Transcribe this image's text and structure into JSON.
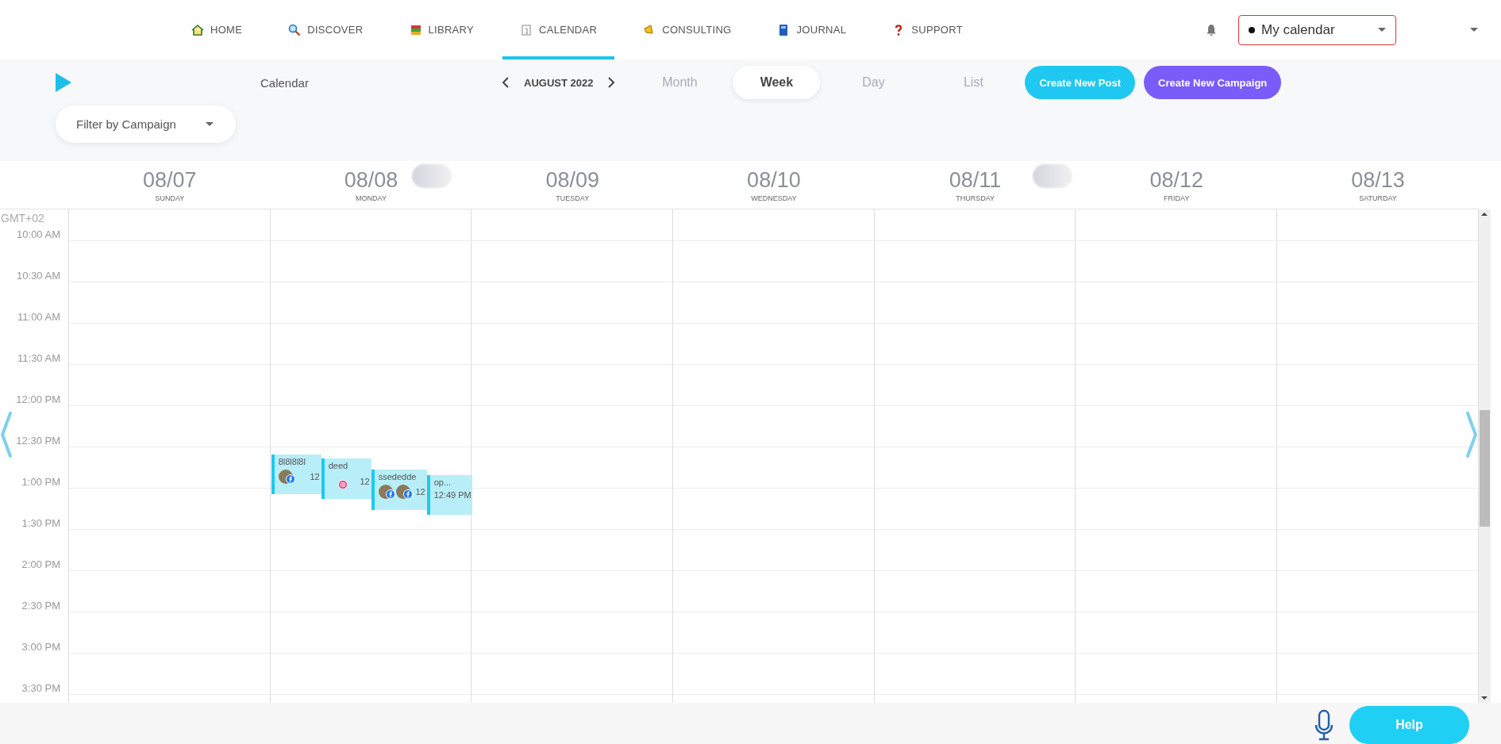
{
  "nav": {
    "items": [
      {
        "label": "HOME",
        "selected": false
      },
      {
        "label": "DISCOVER",
        "selected": false
      },
      {
        "label": "LIBRARY",
        "selected": false
      },
      {
        "label": "CALENDAR",
        "selected": true
      },
      {
        "label": "CONSULTING",
        "selected": false
      },
      {
        "label": "JOURNAL",
        "selected": false
      },
      {
        "label": "SUPPORT",
        "selected": false
      }
    ],
    "calendar_selector": {
      "value": "My calendar"
    }
  },
  "toolbar": {
    "title": "Calendar",
    "period": "AUGUST 2022",
    "views": [
      {
        "label": "Month",
        "selected": false
      },
      {
        "label": "Week",
        "selected": true
      },
      {
        "label": "Day",
        "selected": false
      },
      {
        "label": "List",
        "selected": false
      }
    ],
    "buttons": [
      {
        "label": "Create New Post",
        "kind": "post"
      },
      {
        "label": "Create New Campaign",
        "kind": "campaign"
      }
    ],
    "filter": {
      "value": "Filter by Campaign"
    }
  },
  "days": [
    {
      "date": "08/07",
      "weekday": "SUNDAY"
    },
    {
      "date": "08/08",
      "weekday": "MONDAY"
    },
    {
      "date": "08/09",
      "weekday": "TUESDAY"
    },
    {
      "date": "08/10",
      "weekday": "WEDNESDAY"
    },
    {
      "date": "08/11",
      "weekday": "THURSDAY"
    },
    {
      "date": "08/12",
      "weekday": "FRIDAY"
    },
    {
      "date": "08/13",
      "weekday": "SATURDAY"
    }
  ],
  "timezone": "GMT+02",
  "times": [
    "10:00 AM",
    "10:30 AM",
    "11:00 AM",
    "11:30 AM",
    "12:00 PM",
    "12:30 PM",
    "1:00 PM",
    "1:30 PM",
    "2:00 PM",
    "2:30 PM",
    "3:00 PM",
    "3:30 PM"
  ],
  "events": [
    {
      "title": "8l8l8l8l",
      "time": "12",
      "accounts": [
        {
          "kind": "facebook",
          "avatar": true
        }
      ]
    },
    {
      "title": "deed",
      "time": "12",
      "accounts": [
        {
          "kind": "instagram",
          "avatar": false
        }
      ]
    },
    {
      "title": "ssededde",
      "time": "12",
      "accounts": [
        {
          "kind": "facebook",
          "avatar": true
        },
        {
          "kind": "facebook",
          "avatar": true
        }
      ]
    },
    {
      "title": "op...",
      "time": "12:49 PM"
    }
  ],
  "help": {
    "label": "Help"
  }
}
